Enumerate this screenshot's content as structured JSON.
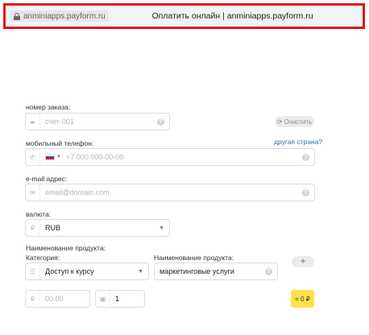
{
  "browser": {
    "url": "anminiapps.payform.ru",
    "page_title": "Оплатить онлайн | anminiapps.payform.ru"
  },
  "form": {
    "order": {
      "label": "номер заказа:",
      "placeholder": "счет-001",
      "clear_label": "Очистить"
    },
    "phone": {
      "label": "мобильный телефон:",
      "other_country_link": "другая страна?",
      "placeholder": "+7 000 000-00-00"
    },
    "email": {
      "label": "e-mail адрес:",
      "placeholder": "email@domain.com"
    },
    "currency": {
      "label": "валюта:",
      "symbol": "₽",
      "value": "RUB"
    },
    "product_section_label": "Наименование продукта:",
    "category": {
      "label": "Категория:",
      "value": "Доступ к курсу"
    },
    "product_name": {
      "label": "Наименование продукта:",
      "value": "маркетинговые услуги"
    },
    "price": {
      "symbol": "₽",
      "placeholder": "00.00"
    },
    "quantity": {
      "value": "1"
    },
    "total": "= 0 ₽"
  },
  "icons": {
    "help": "?",
    "plus": "+"
  },
  "colors": {
    "highlight_border": "#e0161b",
    "link": "#2a6ebb",
    "total_badge": "#ffe14d"
  }
}
